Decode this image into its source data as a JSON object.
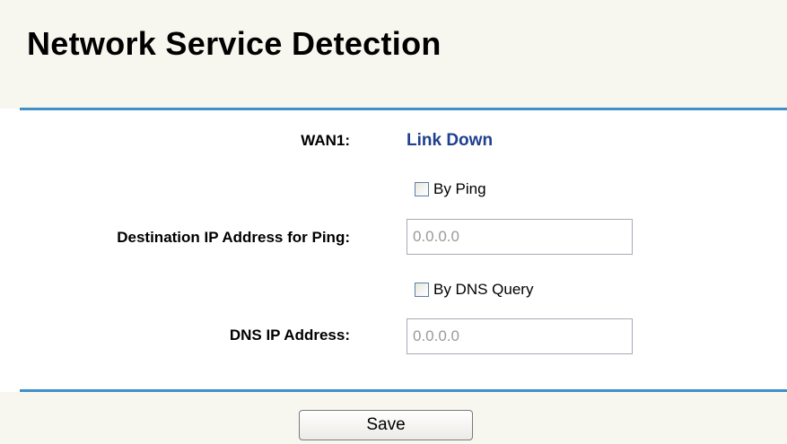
{
  "page": {
    "title": "Network Service Detection"
  },
  "form": {
    "wan_label": "WAN1:",
    "wan_status": "Link Down",
    "by_ping": {
      "label": "By Ping",
      "checked": false
    },
    "ping_destination": {
      "label": "Destination IP Address for Ping:",
      "value": "0.0.0.0"
    },
    "by_dns": {
      "label": "By DNS Query",
      "checked": false
    },
    "dns_ip": {
      "label": "DNS IP Address:",
      "value": "0.0.0.0"
    }
  },
  "actions": {
    "save_label": "Save"
  },
  "colors": {
    "background": "#f7f6ef",
    "divider": "#3f8fc8",
    "status_text": "#1f3f8f",
    "input_text": "#9a9a9a"
  }
}
